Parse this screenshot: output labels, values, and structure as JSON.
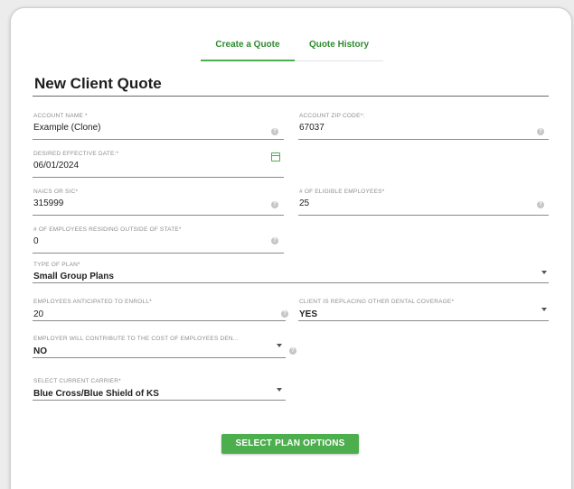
{
  "tabs": {
    "create": "Create a Quote",
    "history": "Quote History"
  },
  "page_title": "New Client Quote",
  "fields": {
    "account_name": {
      "label": "ACCOUNT NAME *",
      "value": "Example (Clone)"
    },
    "account_zip": {
      "label": "ACCOUNT ZIP CODE*:",
      "value": "67037"
    },
    "effective_date": {
      "label": "DESIRED EFFECTIVE DATE:*",
      "value": "06/01/2024"
    },
    "naics": {
      "label": "NAICS OR SIC*",
      "value": "315999"
    },
    "eligible_employees": {
      "label": "# OF ELIGIBLE EMPLOYEES*",
      "value": "25"
    },
    "outside_state": {
      "label": "# OF EMPLOYEES RESIDING OUTSIDE OF STATE*",
      "value": "0"
    },
    "plan_type": {
      "label": "TYPE OF PLAN*",
      "value": "Small Group Plans"
    },
    "anticipated_enroll": {
      "label": "EMPLOYEES ANTICIPATED TO ENROLL*",
      "value": "20"
    },
    "replacing_coverage": {
      "label": "CLIENT IS REPLACING OTHER DENTAL COVERAGE*",
      "value": "YES"
    },
    "employer_contribute": {
      "label": "EMPLOYER WILL CONTRIBUTE TO THE COST OF EMPLOYEES DEN...",
      "value": "NO"
    },
    "current_carrier": {
      "label": "SELECT CURRENT CARRIER*",
      "value": "Blue Cross/Blue Shield of KS"
    }
  },
  "buttons": {
    "select_plan": "SELECT PLAN OPTIONS"
  },
  "colors": {
    "accent": "#4cae4c",
    "tab_text": "#2f8a2f"
  },
  "icons": {
    "help": "question-circle",
    "calendar": "calendar",
    "dropdown": "caret-down"
  }
}
